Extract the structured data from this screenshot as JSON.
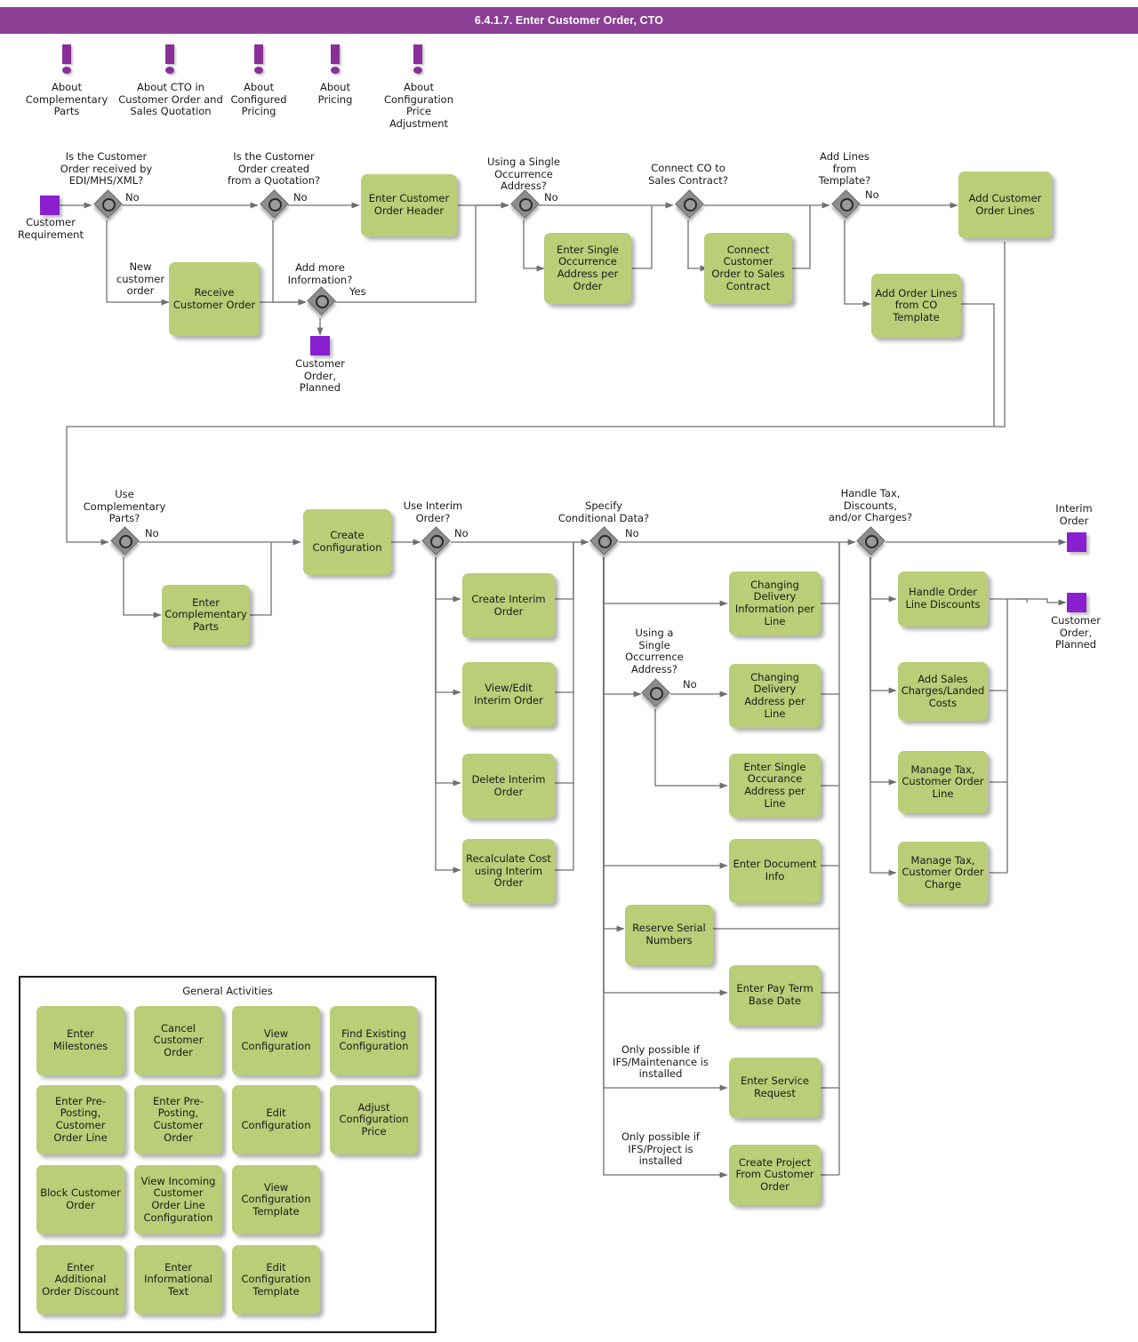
{
  "header": {
    "title": "6.4.1.7. Enter Customer Order, CTO",
    "bar_color": "#8a3f94"
  },
  "palette": {
    "task_green": "#bacd77",
    "event_purple": "#8a1fd0",
    "info_purple": "#8a2f9a",
    "gateway_gray": "#8d8d8d",
    "connector_gray": "#6f6f6f"
  },
  "info_links": [
    {
      "label": "About\nComplementary\nParts"
    },
    {
      "label": "About CTO in\nCustomer Order and\nSales Quotation"
    },
    {
      "label": "About\nConfigured\nPricing"
    },
    {
      "label": "About\nPricing"
    },
    {
      "label": "About\nConfiguration\nPrice\nAdjustment"
    }
  ],
  "events": [
    {
      "id": "customer-requirement",
      "label": "Customer\nRequirement"
    },
    {
      "id": "customer-order-planned-top",
      "label": "Customer\nOrder,\nPlanned"
    },
    {
      "id": "interim-order",
      "label": "Interim\nOrder"
    },
    {
      "id": "customer-order-planned-right",
      "label": "Customer\nOrder,\nPlanned"
    }
  ],
  "gateways": [
    {
      "id": "gw-edi",
      "question": "Is the Customer\nOrder received by\nEDI/MHS/XML?",
      "no": "No",
      "alt": "New\ncustomer\norder"
    },
    {
      "id": "gw-quotation",
      "question": "Is the Customer\nOrder created\nfrom a Quotation?",
      "no": "No"
    },
    {
      "id": "gw-add-more-info",
      "question": "Add more\nInformation?",
      "yes": "Yes"
    },
    {
      "id": "gw-single-occurrence-order",
      "question": "Using a Single\nOccurrence\nAddress?",
      "no": "No"
    },
    {
      "id": "gw-sales-contract",
      "question": "Connect CO to\nSales Contract?"
    },
    {
      "id": "gw-template",
      "question": "Add Lines\nfrom\nTemplate?",
      "no": "No"
    },
    {
      "id": "gw-complementary",
      "question": "Use\nComplementary\nParts?",
      "no": "No"
    },
    {
      "id": "gw-interim",
      "question": "Use Interim\nOrder?",
      "no": "No"
    },
    {
      "id": "gw-conditional",
      "question": "Specify\nConditional Data?",
      "no": "No"
    },
    {
      "id": "gw-single-occurrence-line",
      "question": "Using a\nSingle\nOccurrence\nAddress?",
      "no": "No"
    },
    {
      "id": "gw-tax",
      "question": "Handle Tax,\nDiscounts,\nand/or Charges?"
    }
  ],
  "tasks": [
    {
      "id": "receive-customer-order",
      "label": "Receive\nCustomer Order"
    },
    {
      "id": "enter-customer-order-header",
      "label": "Enter Customer\nOrder Header"
    },
    {
      "id": "enter-single-occurrence-address-per-order",
      "label": "Enter Single\nOccurrence\nAddress per\nOrder"
    },
    {
      "id": "connect-customer-order-to-sales-contract",
      "label": "Connect\nCustomer Order\nto Sales\nContract"
    },
    {
      "id": "add-customer-order-lines",
      "label": "Add Customer\nOrder Lines"
    },
    {
      "id": "add-order-lines-from-co-template",
      "label": "Add Order Lines\nfrom CO\nTemplate"
    },
    {
      "id": "enter-complementary-parts",
      "label": "Enter\nComplementary\nParts"
    },
    {
      "id": "create-configuration",
      "label": "Create\nConfiguration"
    },
    {
      "id": "create-interim-order",
      "label": "Create Interim\nOrder"
    },
    {
      "id": "view-edit-interim-order",
      "label": "View/Edit\nInterim Order"
    },
    {
      "id": "delete-interim-order",
      "label": "Delete Interim\nOrder"
    },
    {
      "id": "recalculate-cost-using-interim-order",
      "label": "Recalculate Cost\nusing Interim\nOrder"
    },
    {
      "id": "changing-delivery-information-per-line",
      "label": "Changing\nDelivery\nInformation per\nLine"
    },
    {
      "id": "changing-delivery-address-per-line",
      "label": "Changing\nDelivery\nAddress per Line"
    },
    {
      "id": "enter-single-occurance-address-per-line",
      "label": "Enter Single\nOccurance\nAddress per Line"
    },
    {
      "id": "enter-document-info",
      "label": "Enter Document\nInfo"
    },
    {
      "id": "reserve-serial-numbers",
      "label": "Reserve Serial\nNumbers"
    },
    {
      "id": "enter-pay-term-base-date",
      "label": "Enter Pay Term\nBase Date"
    },
    {
      "id": "enter-service-request",
      "label": "Enter Service\nRequest"
    },
    {
      "id": "create-project-from-customer-order",
      "label": "Create Project\nFrom Customer\nOrder"
    },
    {
      "id": "handle-order-line-discounts",
      "label": "Handle Order\nLine Discounts"
    },
    {
      "id": "add-sales-charges-landed-costs",
      "label": "Add Sales\nCharges/Landed\nCosts"
    },
    {
      "id": "manage-tax-customer-order-line",
      "label": "Manage Tax,\nCustomer Order\nLine"
    },
    {
      "id": "manage-tax-customer-order-charge",
      "label": "Manage Tax,\nCustomer Order\nCharge"
    }
  ],
  "conditions": [
    {
      "id": "cond-maintenance",
      "label": "Only possible if\nIFS/Maintenance is\ninstalled"
    },
    {
      "id": "cond-project",
      "label": "Only possible if\nIFS/Project is\ninstalled"
    }
  ],
  "legend": {
    "title": "General Activities",
    "items": [
      {
        "label": "Enter Milestones"
      },
      {
        "label": "Cancel\nCustomer Order"
      },
      {
        "label": "View\nConfiguration"
      },
      {
        "label": "Find\nExisting\nConfiguration"
      },
      {
        "label": "Enter Pre-\nPosting,\nCustomer Order\nLine"
      },
      {
        "label": "Enter Pre-\nPosting,\nCustomer Order"
      },
      {
        "label": "Edit\nConfiguration"
      },
      {
        "label": "Adjust\nConfiguration\nPrice"
      },
      {
        "label": "Block Customer\nOrder"
      },
      {
        "label": "View Incoming\nCustomer Order\nLine\nConfiguration"
      },
      {
        "label": "View\nConfiguration\nTemplate"
      },
      {
        "label": "Enter Additional\nOrder Discount"
      },
      {
        "label": "Enter\nInformational\nText"
      },
      {
        "label": "Edit\nConfiguration\nTemplate"
      }
    ]
  }
}
